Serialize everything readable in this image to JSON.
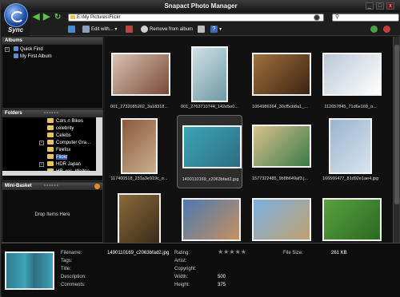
{
  "app": {
    "title": "Snapact Photo Manager",
    "sync_label": "Sync"
  },
  "window_controls": [
    "_",
    "□",
    "x"
  ],
  "nav": {
    "address": "E:\\My Pictures\\Flickr",
    "search_placeholder": ""
  },
  "toolbar": {
    "edit_with": "Edit with...",
    "remove_from_album": "Remove from album"
  },
  "albums": {
    "header": "Albums",
    "items": [
      "Quick Find",
      "My First Album"
    ]
  },
  "folders": {
    "header": "Folders",
    "dots": "••••••",
    "items": [
      "Cars n Bikes",
      "celebrity",
      "Celebs",
      "Computer Gra...",
      "Firefox",
      "Flickr",
      "HDR Japan",
      "HR_res_Wallpa..."
    ],
    "selected_index": 5
  },
  "mini_basket": {
    "header": "Mini-Basket",
    "dots": "••••••",
    "drop_text": "Drop Items Here"
  },
  "thumbnails": [
    {
      "caption": "001_2732085202_3a18318...",
      "colors": [
        "#d8c3b0",
        "#7a4a3a"
      ]
    },
    {
      "caption": "001_2763710744_142e5e0...",
      "colors": [
        "#cfe0e6",
        "#6f9aa6"
      ]
    },
    {
      "caption": "1064986364_30cf5cb8a1_...",
      "colors": [
        "#a0703a",
        "#3a2414"
      ]
    },
    {
      "caption": "112657845_71d6e169_o...",
      "colors": [
        "#b9c8d6",
        "#ffffff"
      ]
    },
    {
      "caption": "117400518_231a3e919c_o...",
      "colors": [
        "#8a5a3a",
        "#c8b090"
      ]
    },
    {
      "caption": "1490110169_c2063bfad2.jpg",
      "colors": [
        "#3ea3b8",
        "#2a6f80"
      ]
    },
    {
      "caption": "1577322485_9b8b649af3.j...",
      "colors": [
        "#d9c28a",
        "#3a7a4a"
      ]
    },
    {
      "caption": "166566477_81d92e1ae4.jpg",
      "colors": [
        "#9ab4d0",
        "#d8e4ef"
      ]
    },
    {
      "caption": "",
      "colors": [
        "#8a6a3a",
        "#3a2a1a"
      ]
    },
    {
      "caption": "",
      "colors": [
        "#4a7ab0",
        "#c89060"
      ]
    },
    {
      "caption": "",
      "colors": [
        "#7ab0e0",
        "#c0a070"
      ]
    },
    {
      "caption": "",
      "colors": [
        "#5aa040",
        "#2a6a20"
      ]
    }
  ],
  "details": {
    "filename_label": "Filename:",
    "filename": "1490110169_c2063bfad2.jpg",
    "tags_label": "Tags:",
    "title_label": "Title:",
    "description_label": "Description:",
    "comments_label": "Comments:",
    "rating_label": "Rating:",
    "rating_stars": "★★★★★",
    "artist_label": "Artist:",
    "copyright_label": "Copyright:",
    "width_label": "Width:",
    "width": "500",
    "height_label": "Height:",
    "height": "375",
    "filesize_label": "File Size:",
    "filesize": "261 KB"
  }
}
